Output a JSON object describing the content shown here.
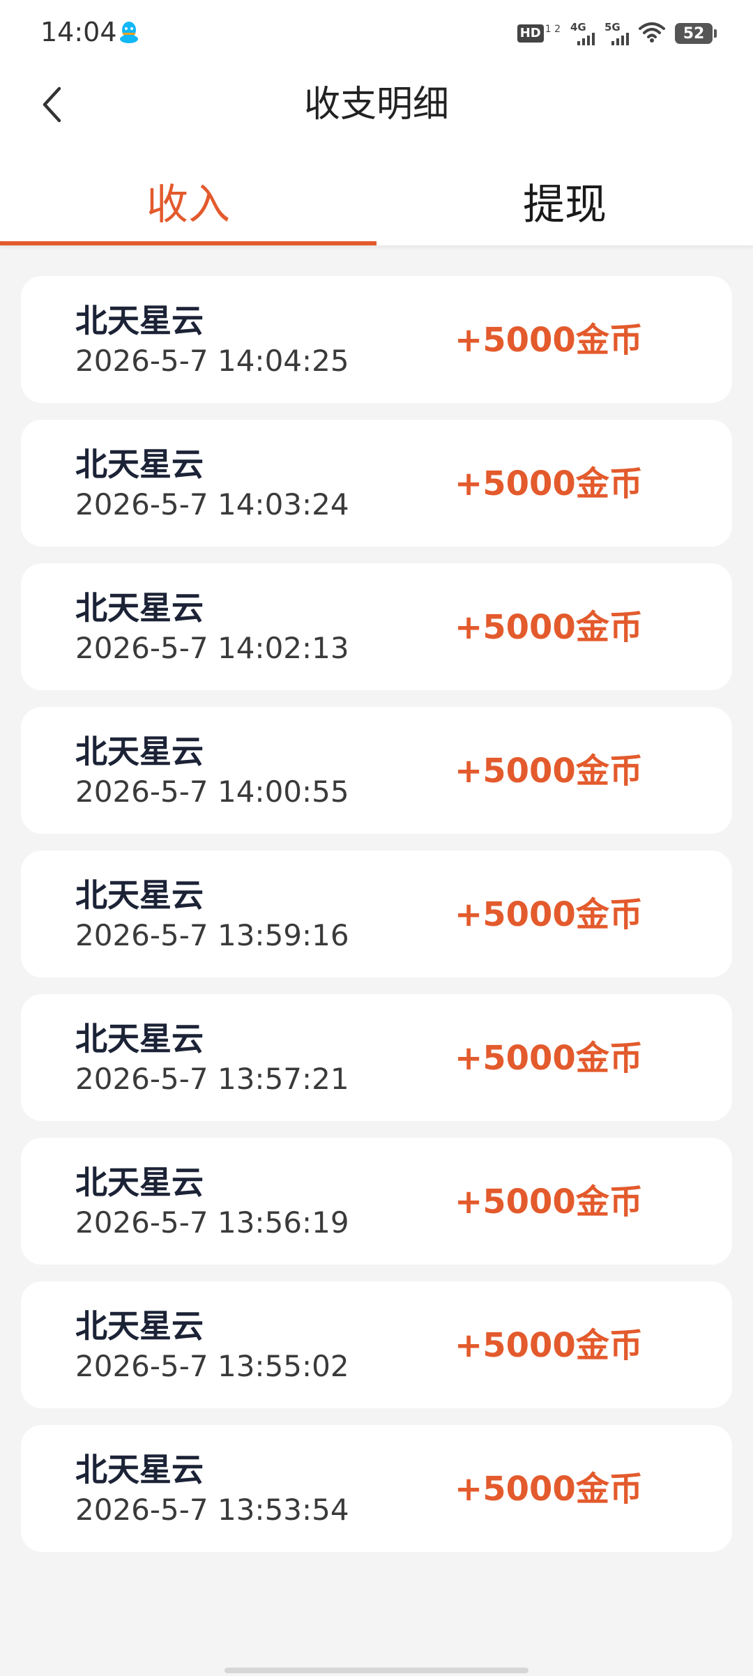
{
  "status_bar": {
    "time": "14:04",
    "hd_label": "HD",
    "hd_sub": "1 2",
    "net1": "4G",
    "net2": "5G",
    "battery": "52"
  },
  "header": {
    "title": "收支明细"
  },
  "tabs": [
    {
      "label": "收入",
      "active": true
    },
    {
      "label": "提现",
      "active": false
    }
  ],
  "records": [
    {
      "name": "北天星云",
      "time": "2026-5-7 14:04:25",
      "amount": "+5000金币"
    },
    {
      "name": "北天星云",
      "time": "2026-5-7 14:03:24",
      "amount": "+5000金币"
    },
    {
      "name": "北天星云",
      "time": "2026-5-7 14:02:13",
      "amount": "+5000金币"
    },
    {
      "name": "北天星云",
      "time": "2026-5-7 14:00:55",
      "amount": "+5000金币"
    },
    {
      "name": "北天星云",
      "time": "2026-5-7 13:59:16",
      "amount": "+5000金币"
    },
    {
      "name": "北天星云",
      "time": "2026-5-7 13:57:21",
      "amount": "+5000金币"
    },
    {
      "name": "北天星云",
      "time": "2026-5-7 13:56:19",
      "amount": "+5000金币"
    },
    {
      "name": "北天星云",
      "time": "2026-5-7 13:55:02",
      "amount": "+5000金币"
    },
    {
      "name": "北天星云",
      "time": "2026-5-7 13:53:54",
      "amount": "+5000金币"
    }
  ],
  "colors": {
    "accent": "#e35a2c",
    "background": "#f4f4f4",
    "card": "#ffffff",
    "name_text": "#1c2336"
  }
}
